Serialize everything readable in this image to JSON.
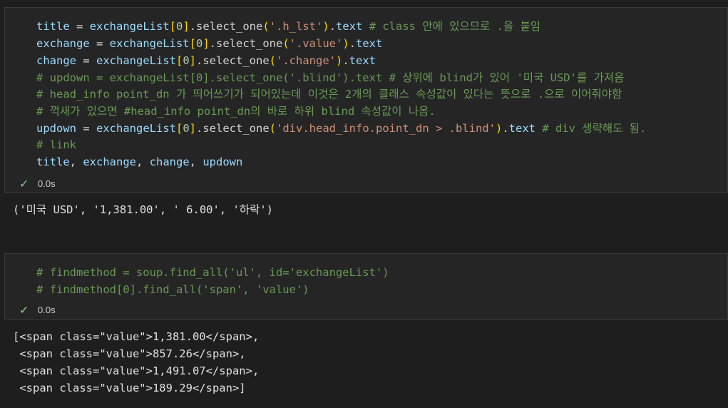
{
  "cell1": {
    "lines": [
      [
        [
          "v",
          "title"
        ],
        [
          "k",
          " = "
        ],
        [
          "v",
          "exchangeList"
        ],
        [
          "b",
          "["
        ],
        [
          "n",
          "0"
        ],
        [
          "b",
          "]"
        ],
        [
          "k",
          ".select_one"
        ],
        [
          "b",
          "("
        ],
        [
          "s",
          "'.h_lst'"
        ],
        [
          "b",
          ")"
        ],
        [
          "k",
          "."
        ],
        [
          "v",
          "text"
        ],
        [
          "c",
          " # class 안에 있으므로 .을 붙임"
        ]
      ],
      [
        [
          "v",
          "exchange"
        ],
        [
          "k",
          " = "
        ],
        [
          "v",
          "exchangeList"
        ],
        [
          "b",
          "["
        ],
        [
          "n",
          "0"
        ],
        [
          "b",
          "]"
        ],
        [
          "k",
          ".select_one"
        ],
        [
          "b",
          "("
        ],
        [
          "s",
          "'.value'"
        ],
        [
          "b",
          ")"
        ],
        [
          "k",
          "."
        ],
        [
          "v",
          "text"
        ]
      ],
      [
        [
          "v",
          "change"
        ],
        [
          "k",
          " = "
        ],
        [
          "v",
          "exchangeList"
        ],
        [
          "b",
          "["
        ],
        [
          "n",
          "0"
        ],
        [
          "b",
          "]"
        ],
        [
          "k",
          ".select_one"
        ],
        [
          "b",
          "("
        ],
        [
          "s",
          "'.change'"
        ],
        [
          "b",
          ")"
        ],
        [
          "k",
          "."
        ],
        [
          "v",
          "text"
        ]
      ],
      [
        [
          "c",
          "# updown = exchangeList[0].select_one('.blind').text # 상위에 blind가 있어 '미국 USD'를 가져옴"
        ]
      ],
      [
        [
          "c",
          "# head_info point_dn 가 띄어쓰기가 되어있는데 이것은 2개의 클래스 속성값이 있다는 뜻으로 .으로 이어줘야함"
        ]
      ],
      [
        [
          "c",
          "# 꺽새가 있으면 #head_info point_dn의 바로 하위 blind 속성값이 나옴."
        ]
      ],
      [
        [
          "v",
          "updown"
        ],
        [
          "k",
          " = "
        ],
        [
          "v",
          "exchangeList"
        ],
        [
          "b",
          "["
        ],
        [
          "n",
          "0"
        ],
        [
          "b",
          "]"
        ],
        [
          "k",
          ".select_one"
        ],
        [
          "b",
          "("
        ],
        [
          "s",
          "'div.head_info.point_dn > .blind'"
        ],
        [
          "b",
          ")"
        ],
        [
          "k",
          "."
        ],
        [
          "v",
          "text"
        ],
        [
          "c",
          " # div 생략해도 됨."
        ]
      ],
      [
        [
          "c",
          "# link"
        ]
      ],
      [
        [
          "v",
          "title"
        ],
        [
          "k",
          ", "
        ],
        [
          "v",
          "exchange"
        ],
        [
          "k",
          ", "
        ],
        [
          "v",
          "change"
        ],
        [
          "k",
          ", "
        ],
        [
          "v",
          "updown"
        ]
      ]
    ],
    "status_check": "✓",
    "status_time": "0.0s",
    "output": [
      "('미국 USD', '1,381.00', ' 6.00', '하락')"
    ]
  },
  "cell2": {
    "lines": [
      [
        [
          "c",
          "# findmethod = soup.find_all('ul', id='exchangeList')"
        ]
      ],
      [
        [
          "c",
          "# findmethod[0].find_all('span', 'value')"
        ]
      ]
    ],
    "status_check": "✓",
    "status_time": "0.0s",
    "output": [
      "[<span class=\"value\">1,381.00</span>,",
      " <span class=\"value\">857.26</span>,",
      " <span class=\"value\">1,491.07</span>,",
      " <span class=\"value\">189.29</span>]"
    ]
  }
}
